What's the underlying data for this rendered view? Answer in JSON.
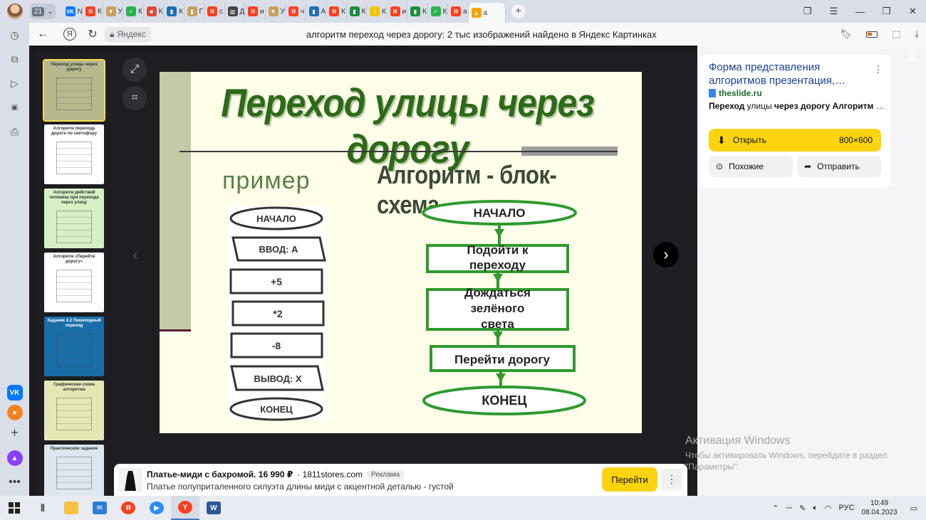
{
  "tabbar": {
    "tab_count": "21",
    "tabs": [
      {
        "icon": "vk-icon",
        "label": "N",
        "color": "#0077ff",
        "glyph": "VK"
      },
      {
        "icon": "yandex-icon",
        "label": "К",
        "color": "#fc3f1d",
        "glyph": "Я"
      },
      {
        "icon": "bookmark-icon",
        "label": "У",
        "color": "#c8a060",
        "glyph": "▼"
      },
      {
        "icon": "check-icon",
        "label": "К",
        "color": "#2bb24c",
        "glyph": "✓"
      },
      {
        "icon": "page-icon",
        "label": "К",
        "color": "#e04a3a",
        "glyph": "■"
      },
      {
        "icon": "book-icon",
        "label": "К",
        "color": "#1f6fb5",
        "glyph": "▮"
      },
      {
        "icon": "book-icon",
        "label": "Г",
        "color": "#c8a060",
        "glyph": "▮"
      },
      {
        "icon": "yandex-icon",
        "label": "с",
        "color": "#fc3f1d",
        "glyph": "Я"
      },
      {
        "icon": "chart-icon",
        "label": "Д",
        "color": "#444444",
        "glyph": "▥"
      },
      {
        "icon": "yandex-icon",
        "label": "и",
        "color": "#fc3f1d",
        "glyph": "Я"
      },
      {
        "icon": "bookmark-icon",
        "label": "У",
        "color": "#c8a060",
        "glyph": "▼"
      },
      {
        "icon": "yandex-icon",
        "label": "ч",
        "color": "#fc3f1d",
        "glyph": "Я"
      },
      {
        "icon": "book-icon",
        "label": "А",
        "color": "#1f6fb5",
        "glyph": "▮"
      },
      {
        "icon": "yandex-icon",
        "label": "К",
        "color": "#fc3f1d",
        "glyph": "Я"
      },
      {
        "icon": "green-doc-icon",
        "label": "К",
        "color": "#1e8e3e",
        "glyph": "▮"
      },
      {
        "icon": "info-icon",
        "label": "К",
        "color": "#f5c400",
        "glyph": "i"
      },
      {
        "icon": "yandex-icon",
        "label": "и",
        "color": "#fc3f1d",
        "glyph": "Я"
      },
      {
        "icon": "green-doc-icon",
        "label": "К",
        "color": "#1e8e3e",
        "glyph": "▮"
      },
      {
        "icon": "check-icon",
        "label": "К",
        "color": "#2bb24c",
        "glyph": "✓"
      },
      {
        "icon": "yandex-icon",
        "label": "а",
        "color": "#fc3f1d",
        "glyph": "Я"
      }
    ],
    "active_tab": {
      "icon": "image-search-icon",
      "label": "а",
      "color": "#f5a300",
      "glyph": "▲"
    }
  },
  "address": {
    "site_chip": "Яндекс",
    "page_title": "алгоритм переход через дорогу: 2 тыс изображений найдено в Яндекс Картинках"
  },
  "slide": {
    "title": "Переход улицы через дорогу",
    "example_label": "пример",
    "algo_label": "Алгоритм - блок-схема",
    "left_flow": [
      "НАЧАЛО",
      "ВВОД: А",
      "+5",
      "*2",
      "-8",
      "ВЫВОД: Х",
      "КОНЕЦ"
    ],
    "right_flow": [
      "НАЧАЛО",
      "Подойти к переходу",
      "Дождаться зелёного света",
      "Перейти дорогу",
      "КОНЕЦ"
    ]
  },
  "thumbnails": [
    {
      "caption": "Переход улицы через дорогу",
      "bg": "#b6b98e"
    },
    {
      "caption": "Алгоритм перехода дороги по светофору",
      "bg": "#ffffff"
    },
    {
      "caption": "Алгоритм действий человека при переходе через улицу",
      "bg": "#d6efc4"
    },
    {
      "caption": "Алгоритм «Перейти дорогу»",
      "bg": "#ffffff"
    },
    {
      "caption": "Задание 2.2 Пешеходный переход",
      "bg": "#1a6ea8"
    },
    {
      "caption": "Графическая схема алгоритма",
      "bg": "#e5e8b6"
    },
    {
      "caption": "Практическое задание",
      "bg": "#dde6ef"
    }
  ],
  "info": {
    "title": "Форма представления алгоритмов презентация,…",
    "site": "theslide.ru",
    "desc_bold1": "Переход",
    "desc_mid1": " улицы ",
    "desc_bold2": "через дорогу Алгоритм",
    "desc_end": " …",
    "open_label": "Открыть",
    "size": "800×600",
    "similar_label": "Похожие",
    "share_label": "Отправить"
  },
  "activation": {
    "title": "Активация Windows",
    "line1": "Чтобы активировать Windows, перейдите в раздел",
    "line2": "\"Параметры\"."
  },
  "ad": {
    "title": "Платье-миди с бахромой. 16 990 ₽",
    "domain": "· 1811stores.com",
    "badge": "Реклама",
    "desc": "Платье полуприталенного силуэта длины миди с акцентной деталью - густой",
    "go_label": "Перейти"
  },
  "taskbar": {
    "lang": "РУС",
    "time": "10:49",
    "date": "08.04.2023"
  },
  "colors": {
    "accent_yellow": "#fbd30f",
    "link_blue": "#1a3f9e",
    "site_green": "#1a6b34",
    "slide_green": "#2d6a1a"
  }
}
